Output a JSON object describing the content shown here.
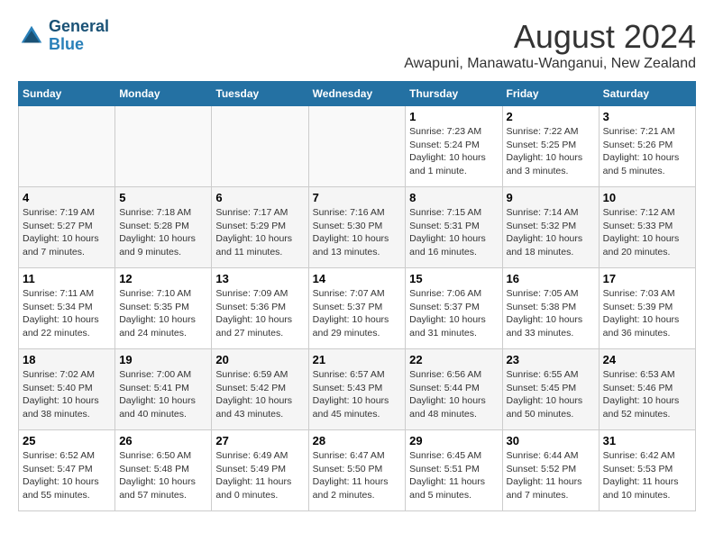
{
  "header": {
    "logo_line1": "General",
    "logo_line2": "Blue",
    "main_title": "August 2024",
    "subtitle": "Awapuni, Manawatu-Wanganui, New Zealand"
  },
  "days_of_week": [
    "Sunday",
    "Monday",
    "Tuesday",
    "Wednesday",
    "Thursday",
    "Friday",
    "Saturday"
  ],
  "weeks": [
    [
      {
        "day": "",
        "info": ""
      },
      {
        "day": "",
        "info": ""
      },
      {
        "day": "",
        "info": ""
      },
      {
        "day": "",
        "info": ""
      },
      {
        "day": "1",
        "info": "Sunrise: 7:23 AM\nSunset: 5:24 PM\nDaylight: 10 hours\nand 1 minute."
      },
      {
        "day": "2",
        "info": "Sunrise: 7:22 AM\nSunset: 5:25 PM\nDaylight: 10 hours\nand 3 minutes."
      },
      {
        "day": "3",
        "info": "Sunrise: 7:21 AM\nSunset: 5:26 PM\nDaylight: 10 hours\nand 5 minutes."
      }
    ],
    [
      {
        "day": "4",
        "info": "Sunrise: 7:19 AM\nSunset: 5:27 PM\nDaylight: 10 hours\nand 7 minutes."
      },
      {
        "day": "5",
        "info": "Sunrise: 7:18 AM\nSunset: 5:28 PM\nDaylight: 10 hours\nand 9 minutes."
      },
      {
        "day": "6",
        "info": "Sunrise: 7:17 AM\nSunset: 5:29 PM\nDaylight: 10 hours\nand 11 minutes."
      },
      {
        "day": "7",
        "info": "Sunrise: 7:16 AM\nSunset: 5:30 PM\nDaylight: 10 hours\nand 13 minutes."
      },
      {
        "day": "8",
        "info": "Sunrise: 7:15 AM\nSunset: 5:31 PM\nDaylight: 10 hours\nand 16 minutes."
      },
      {
        "day": "9",
        "info": "Sunrise: 7:14 AM\nSunset: 5:32 PM\nDaylight: 10 hours\nand 18 minutes."
      },
      {
        "day": "10",
        "info": "Sunrise: 7:12 AM\nSunset: 5:33 PM\nDaylight: 10 hours\nand 20 minutes."
      }
    ],
    [
      {
        "day": "11",
        "info": "Sunrise: 7:11 AM\nSunset: 5:34 PM\nDaylight: 10 hours\nand 22 minutes."
      },
      {
        "day": "12",
        "info": "Sunrise: 7:10 AM\nSunset: 5:35 PM\nDaylight: 10 hours\nand 24 minutes."
      },
      {
        "day": "13",
        "info": "Sunrise: 7:09 AM\nSunset: 5:36 PM\nDaylight: 10 hours\nand 27 minutes."
      },
      {
        "day": "14",
        "info": "Sunrise: 7:07 AM\nSunset: 5:37 PM\nDaylight: 10 hours\nand 29 minutes."
      },
      {
        "day": "15",
        "info": "Sunrise: 7:06 AM\nSunset: 5:37 PM\nDaylight: 10 hours\nand 31 minutes."
      },
      {
        "day": "16",
        "info": "Sunrise: 7:05 AM\nSunset: 5:38 PM\nDaylight: 10 hours\nand 33 minutes."
      },
      {
        "day": "17",
        "info": "Sunrise: 7:03 AM\nSunset: 5:39 PM\nDaylight: 10 hours\nand 36 minutes."
      }
    ],
    [
      {
        "day": "18",
        "info": "Sunrise: 7:02 AM\nSunset: 5:40 PM\nDaylight: 10 hours\nand 38 minutes."
      },
      {
        "day": "19",
        "info": "Sunrise: 7:00 AM\nSunset: 5:41 PM\nDaylight: 10 hours\nand 40 minutes."
      },
      {
        "day": "20",
        "info": "Sunrise: 6:59 AM\nSunset: 5:42 PM\nDaylight: 10 hours\nand 43 minutes."
      },
      {
        "day": "21",
        "info": "Sunrise: 6:57 AM\nSunset: 5:43 PM\nDaylight: 10 hours\nand 45 minutes."
      },
      {
        "day": "22",
        "info": "Sunrise: 6:56 AM\nSunset: 5:44 PM\nDaylight: 10 hours\nand 48 minutes."
      },
      {
        "day": "23",
        "info": "Sunrise: 6:55 AM\nSunset: 5:45 PM\nDaylight: 10 hours\nand 50 minutes."
      },
      {
        "day": "24",
        "info": "Sunrise: 6:53 AM\nSunset: 5:46 PM\nDaylight: 10 hours\nand 52 minutes."
      }
    ],
    [
      {
        "day": "25",
        "info": "Sunrise: 6:52 AM\nSunset: 5:47 PM\nDaylight: 10 hours\nand 55 minutes."
      },
      {
        "day": "26",
        "info": "Sunrise: 6:50 AM\nSunset: 5:48 PM\nDaylight: 10 hours\nand 57 minutes."
      },
      {
        "day": "27",
        "info": "Sunrise: 6:49 AM\nSunset: 5:49 PM\nDaylight: 11 hours\nand 0 minutes."
      },
      {
        "day": "28",
        "info": "Sunrise: 6:47 AM\nSunset: 5:50 PM\nDaylight: 11 hours\nand 2 minutes."
      },
      {
        "day": "29",
        "info": "Sunrise: 6:45 AM\nSunset: 5:51 PM\nDaylight: 11 hours\nand 5 minutes."
      },
      {
        "day": "30",
        "info": "Sunrise: 6:44 AM\nSunset: 5:52 PM\nDaylight: 11 hours\nand 7 minutes."
      },
      {
        "day": "31",
        "info": "Sunrise: 6:42 AM\nSunset: 5:53 PM\nDaylight: 11 hours\nand 10 minutes."
      }
    ]
  ]
}
